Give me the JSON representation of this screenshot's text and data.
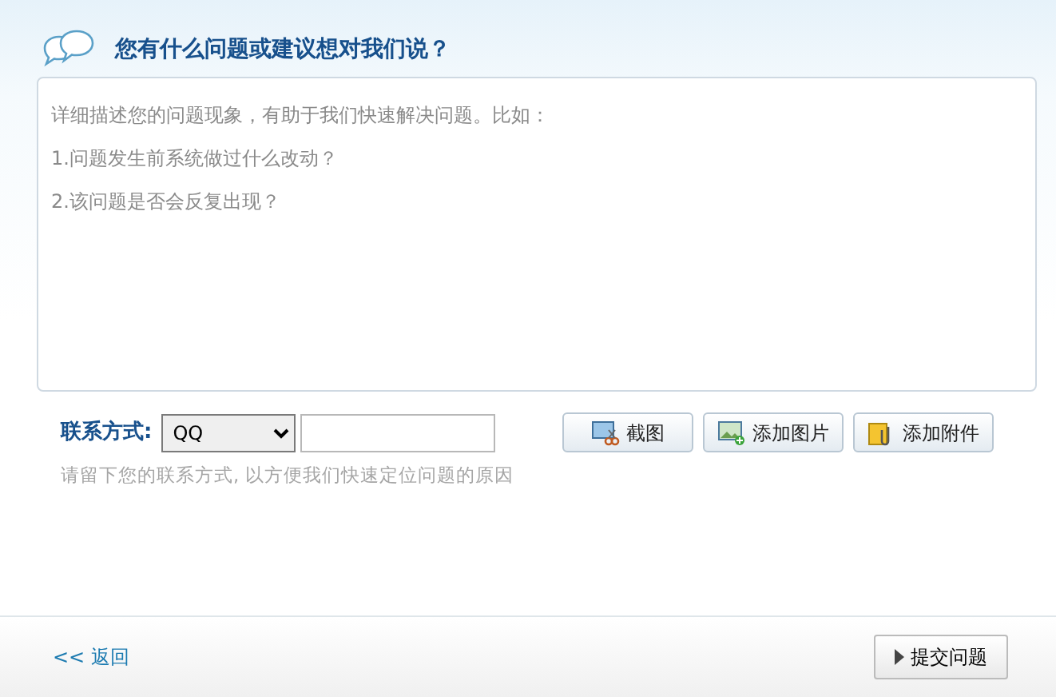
{
  "header": {
    "title": "您有什么问题或建议想对我们说？"
  },
  "description": {
    "placeholder": [
      "详细描述您的问题现象，有助于我们快速解决问题。比如：",
      "1.问题发生前系统做过什么改动？",
      "2.该问题是否会反复出现？"
    ]
  },
  "contact": {
    "label": "联系方式:",
    "method": "QQ",
    "hint": "请留下您的联系方式, 以方便我们快速定位问题的原因"
  },
  "tools": [
    {
      "kind": "screenshot",
      "label": "截图"
    },
    {
      "kind": "image",
      "label": "添加图片"
    },
    {
      "kind": "attachment",
      "label": "添加附件"
    }
  ],
  "footer": {
    "back": "<< 返回",
    "submit": "提交问题"
  }
}
